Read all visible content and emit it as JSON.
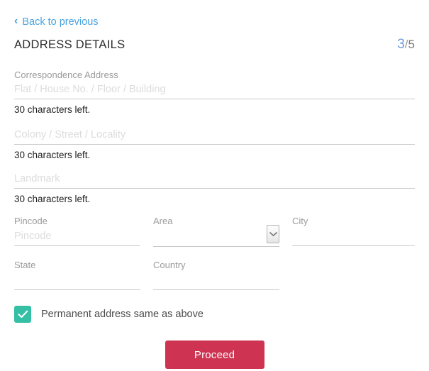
{
  "header": {
    "back_link": "Back to previous",
    "back_icon": "chevron-left-icon",
    "title": "ADDRESS DETAILS",
    "step_current": "3",
    "step_separator": "/",
    "step_total": "5"
  },
  "colors": {
    "link_blue": "#4aa3e0",
    "step_blue": "#6f9ddb",
    "checkbox_teal": "#35bfa4",
    "proceed_crimson": "#ce3452",
    "label_gray": "#9b9b9b",
    "placeholder_gray": "#dcdcdc",
    "underline_gray": "#c9c9c9"
  },
  "form": {
    "address_group_label": "Correspondence Address",
    "line1": {
      "placeholder": "Flat / House No. / Floor / Building",
      "value": "",
      "helper": "30 characters left."
    },
    "line2": {
      "placeholder": "Colony / Street / Locality",
      "value": "",
      "helper": "30 characters left."
    },
    "line3": {
      "placeholder": "Landmark",
      "value": "",
      "helper": "30 characters left."
    },
    "pincode": {
      "label": "Pincode",
      "placeholder": "Pincode",
      "value": ""
    },
    "area": {
      "label": "Area",
      "value": "",
      "dropdown_icon": "chevron-down-icon"
    },
    "city": {
      "label": "City",
      "value": ""
    },
    "state": {
      "label": "State",
      "value": ""
    },
    "country": {
      "label": "Country",
      "value": ""
    },
    "permanent_checkbox": {
      "label": "Permanent address same as above",
      "checked": true,
      "icon": "check-icon"
    }
  },
  "footer": {
    "proceed_label": "Proceed"
  }
}
